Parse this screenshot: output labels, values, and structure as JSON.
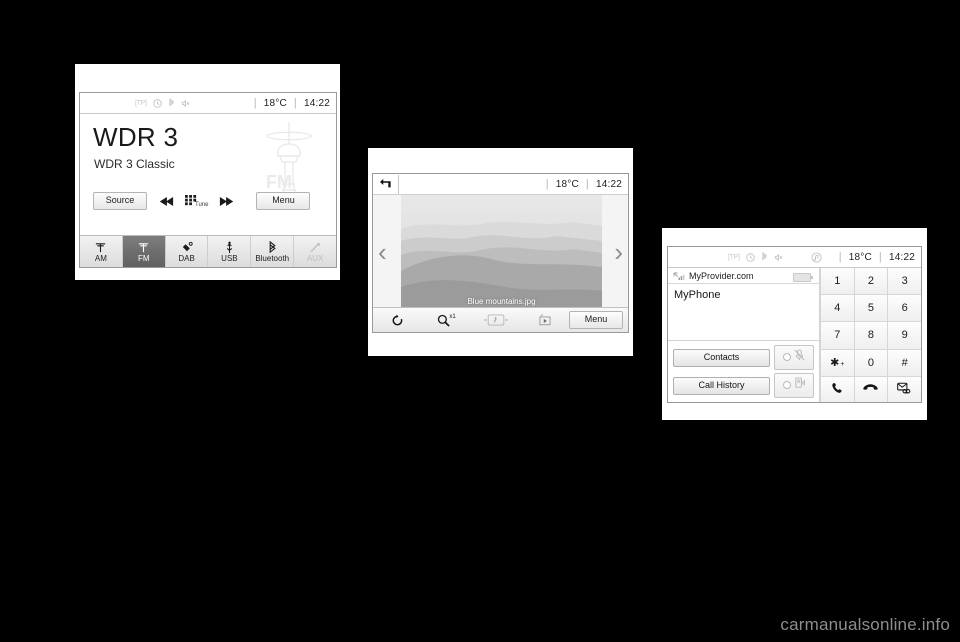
{
  "page": {
    "background_color": "#000000",
    "watermark": "carmanualsonline.info"
  },
  "radio_screen": {
    "status": {
      "tp": "[TP]",
      "icons": [
        "tp-icon",
        "clock-icon",
        "bluetooth-icon",
        "mute-icon"
      ],
      "temperature": "18°C",
      "time": "14:22",
      "separator": "|"
    },
    "station_name": "WDR 3",
    "station_info": "WDR 3 Classic",
    "logo_text": "FM",
    "controls": {
      "source_label": "Source",
      "prev_icon": "skip-back-icon",
      "tune_label": "Tune",
      "tune_icon": "tune-keypad-icon",
      "next_icon": "skip-forward-icon",
      "menu_label": "Menu"
    },
    "tabs": [
      {
        "label": "AM",
        "icon": "antenna-icon",
        "active": false,
        "disabled": false
      },
      {
        "label": "FM",
        "icon": "antenna-icon",
        "active": true,
        "disabled": false
      },
      {
        "label": "DAB",
        "icon": "satellite-icon",
        "active": false,
        "disabled": false
      },
      {
        "label": "USB",
        "icon": "usb-icon",
        "active": false,
        "disabled": false
      },
      {
        "label": "Bluetooth",
        "icon": "bluetooth-icon",
        "active": false,
        "disabled": false
      },
      {
        "label": "AUX",
        "icon": "aux-plug-icon",
        "active": false,
        "disabled": true
      }
    ]
  },
  "photo_screen": {
    "status": {
      "back_icon": "back-arrow-icon",
      "temperature": "18°C",
      "time": "14:22",
      "separator": "|"
    },
    "image_caption": "Blue mountains.jpg",
    "prev_arrow": "‹",
    "next_arrow": "›",
    "toolbar": {
      "rotate_icon": "rotate-icon",
      "zoom_label": "x1",
      "zoom_icon": "magnifier-icon",
      "adjust_icon": "brightness-adjust-icon",
      "slideshow_icon": "slideshow-play-icon",
      "menu_label": "Menu"
    }
  },
  "phone_screen": {
    "status": {
      "tp": "[TP]",
      "icons": [
        "tp-icon",
        "clock-icon",
        "bluetooth-icon",
        "mute-icon",
        "music-note-icon"
      ],
      "temperature": "18°C",
      "time": "14:22",
      "separator": "|"
    },
    "provider": "MyProvider.com",
    "signal_icon": "signal-strength-icon",
    "battery_icon": "battery-icon",
    "device_name": "MyPhone",
    "buttons": {
      "contacts_label": "Contacts",
      "call_history_label": "Call History",
      "mute_mic_icon": "mic-muted-icon",
      "handset_icon": "handset-transfer-icon"
    },
    "keypad": [
      {
        "label": "1",
        "sub": ""
      },
      {
        "label": "2",
        "sub": ""
      },
      {
        "label": "3",
        "sub": ""
      },
      {
        "label": "4",
        "sub": ""
      },
      {
        "label": "5",
        "sub": ""
      },
      {
        "label": "6",
        "sub": ""
      },
      {
        "label": "7",
        "sub": ""
      },
      {
        "label": "8",
        "sub": ""
      },
      {
        "label": "9",
        "sub": ""
      },
      {
        "label": "✱",
        "sub": "+"
      },
      {
        "label": "0",
        "sub": ""
      },
      {
        "label": "#",
        "sub": ""
      }
    ],
    "call_actions": {
      "call_icon": "call-icon",
      "end_call_icon": "end-call-icon",
      "voicemail_icon": "voicemail-icon"
    }
  }
}
